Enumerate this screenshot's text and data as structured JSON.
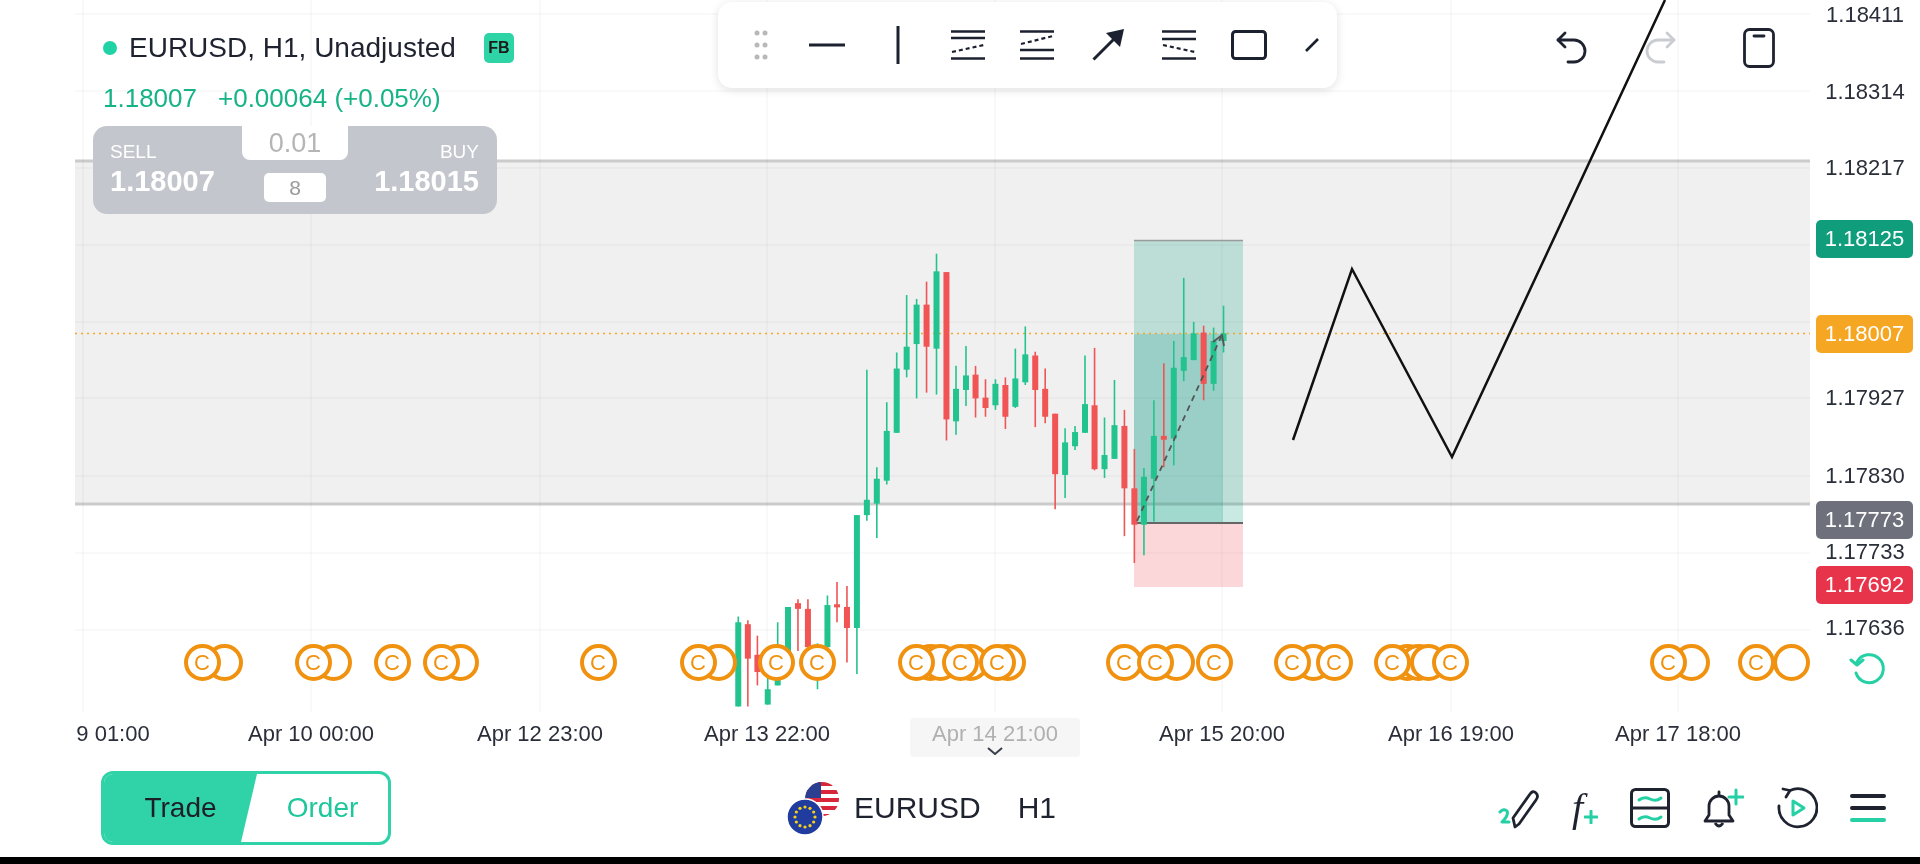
{
  "header": {
    "title": "EURUSD, H1, Unadjusted",
    "badge": "FB",
    "last_price": "1.18007",
    "change": "+0.00064 (+0.05%)"
  },
  "trade_panel": {
    "sell": {
      "label": "SELL",
      "price": "1.18007"
    },
    "volume": {
      "value": "0.01"
    },
    "spread": "8",
    "buy": {
      "label": "BUY",
      "price": "1.18015"
    }
  },
  "history": {
    "undo": {
      "disabled": false
    },
    "redo": {
      "disabled": true
    }
  },
  "chart": {
    "price_labels": [
      "1.18411",
      "1.18314",
      "1.18217",
      "1.17927",
      "1.17830",
      "1.17733",
      "1.17636"
    ],
    "price_badges": [
      {
        "label": "1.18125",
        "color": "#0f9d7c"
      },
      {
        "label": "1.18007",
        "color": "#f5a623"
      },
      {
        "label": "1.17773",
        "color": "#6e717c"
      },
      {
        "label": "1.17692",
        "color": "#e8344a"
      }
    ],
    "event_markers": [
      {
        "label": "C"
      },
      {
        "label": "C"
      },
      {
        "label": "C"
      },
      {
        "label": "C"
      },
      {
        "label": "C"
      },
      {
        "label": "C"
      },
      {
        "label": "C"
      },
      {
        "label": "C"
      },
      {
        "label": "C"
      },
      {
        "label": "C"
      },
      {
        "label": "C"
      },
      {
        "label": "C"
      },
      {
        "label": "C"
      },
      {
        "label": "C"
      },
      {
        "label": "C"
      },
      {
        "label": "C"
      },
      {
        "label": "C"
      },
      {
        "label": "C"
      },
      {
        "label": "C"
      },
      {
        "label": "C"
      }
    ],
    "time_labels": [
      {
        "label": "9 01:00",
        "kind": "tick"
      },
      {
        "label": "Apr 10 00:00",
        "kind": "tick"
      },
      {
        "label": "Apr 12 23:00",
        "kind": "tick"
      },
      {
        "label": "Apr 13 22:00",
        "kind": "tick"
      },
      {
        "label": "Apr 14 21:00",
        "kind": "crosshair"
      },
      {
        "label": "Apr 15 20:00",
        "kind": "tick"
      },
      {
        "label": "Apr 16 19:00",
        "kind": "tick"
      },
      {
        "label": "Apr 17 18:00",
        "kind": "tick"
      }
    ]
  },
  "bottom_bar": {
    "modes": [
      {
        "label": "Trade",
        "selected": true
      },
      {
        "label": "Order",
        "selected": false
      }
    ],
    "symbol": "EURUSD",
    "timeframe": "H1",
    "indicators_label": "f"
  }
}
